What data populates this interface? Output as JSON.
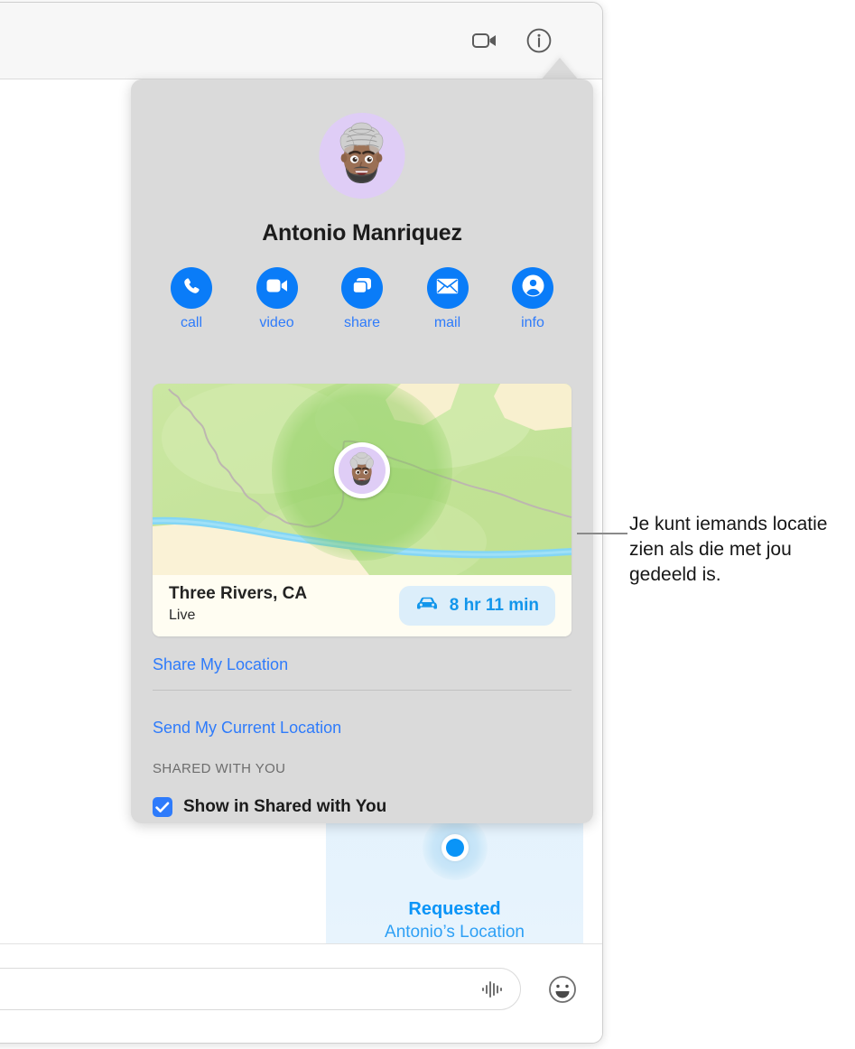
{
  "window": {
    "toolbar": {
      "facetime_icon": "video-camera-icon",
      "details_icon": "info-circle-icon"
    },
    "compose": {
      "placeholder": "",
      "value": "",
      "audio_icon": "audio-waveform-icon",
      "emoji_icon": "smiley-face-icon"
    }
  },
  "conversation": {
    "location_bubble": {
      "icon": "location-dot-icon",
      "title": "Requested",
      "subtitle": "Antonio’s Location"
    }
  },
  "popover": {
    "contact_name": "Antonio Manriquez",
    "avatar_icon": "memoji-avatar",
    "actions": [
      {
        "label": "call",
        "icon": "phone-icon"
      },
      {
        "label": "video",
        "icon": "video-camera-icon"
      },
      {
        "label": "share",
        "icon": "screen-share-icon"
      },
      {
        "label": "mail",
        "icon": "envelope-icon"
      },
      {
        "label": "info",
        "icon": "person-circle-icon"
      }
    ],
    "map": {
      "place": "Three Rivers, CA",
      "status": "Live",
      "drive_icon": "car-icon",
      "drive_time": "8 hr 11 min",
      "pin_icon": "memoji-avatar"
    },
    "links": [
      {
        "label": "Share My Location"
      },
      {
        "label": "Send My Current Location"
      }
    ],
    "shared_with_you": {
      "header": "SHARED WITH YOU",
      "checkbox_checked": true,
      "label": "Show in Shared with You"
    }
  },
  "annotation": {
    "text": "Je kunt iemands locatie zien als die met jou gedeeld is."
  },
  "colors": {
    "accent_blue": "#0a7cf8",
    "link_blue": "#2e7bfb",
    "bubble_blue": "#0a94f7",
    "popover_bg": "#dadada",
    "map_green": "#c9e59f",
    "map_sand": "#faf0d0",
    "map_water": "#7fd4f5"
  }
}
